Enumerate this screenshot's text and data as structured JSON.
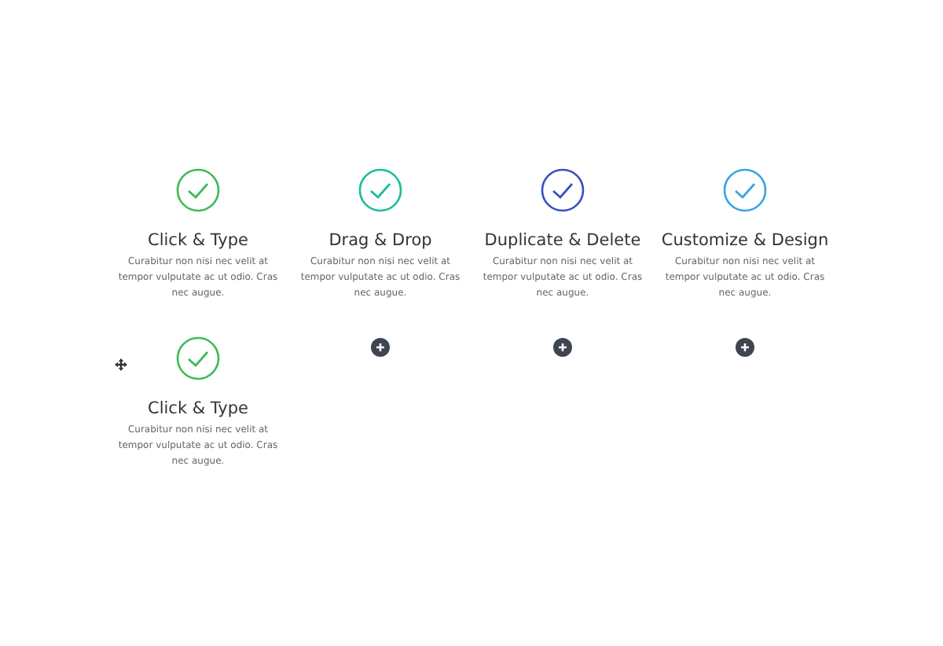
{
  "rows": [
    {
      "cells": [
        {
          "kind": "feature",
          "color": "#3dba55",
          "title": "Click & Type",
          "text": "Curabitur non nisi nec velit at tempor vulputate ac ut odio. Cras nec augue."
        },
        {
          "kind": "feature",
          "color": "#1bbc9b",
          "title": "Drag & Drop",
          "text": "Curabitur non nisi nec velit at tempor vulputate ac ut odio. Cras nec augue."
        },
        {
          "kind": "feature",
          "color": "#3a4fc4",
          "title": "Duplicate & Delete",
          "text": "Curabitur non nisi nec velit at tempor vulputate ac ut odio. Cras nec augue."
        },
        {
          "kind": "feature",
          "color": "#3aa3e3",
          "title": "Customize & Design",
          "text": "Curabitur non nisi nec velit at tempor vulputate ac ut odio. Cras nec augue."
        }
      ]
    },
    {
      "cells": [
        {
          "kind": "feature",
          "color": "#3dba55",
          "title": "Click & Type",
          "text": "Curabitur non nisi nec velit at tempor vulputate ac ut odio. Cras nec augue."
        },
        {
          "kind": "add"
        },
        {
          "kind": "add"
        },
        {
          "kind": "add"
        }
      ]
    }
  ]
}
